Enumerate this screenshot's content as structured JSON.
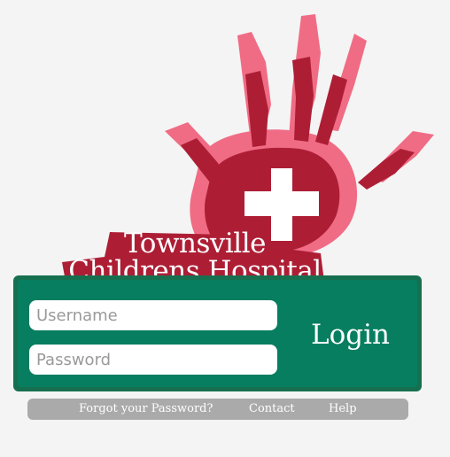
{
  "brand": {
    "line1": "Townsville",
    "line2": "Childrens Hospital"
  },
  "login": {
    "username_placeholder": "Username",
    "password_placeholder": "Password",
    "button_label": "Login"
  },
  "footer": {
    "forgot_label": "Forgot your Password?",
    "contact_label": "Contact",
    "help_label": "Help"
  },
  "colors": {
    "background": "#f4f4f4",
    "hand_outer": "#f06c85",
    "hand_inner": "#ad1e35",
    "panel_border": "#16704f",
    "panel_fill": "#087e60",
    "footer_bar": "#aaaaaa"
  },
  "icons": {
    "logo": "red-hand-with-white-cross-icon"
  }
}
